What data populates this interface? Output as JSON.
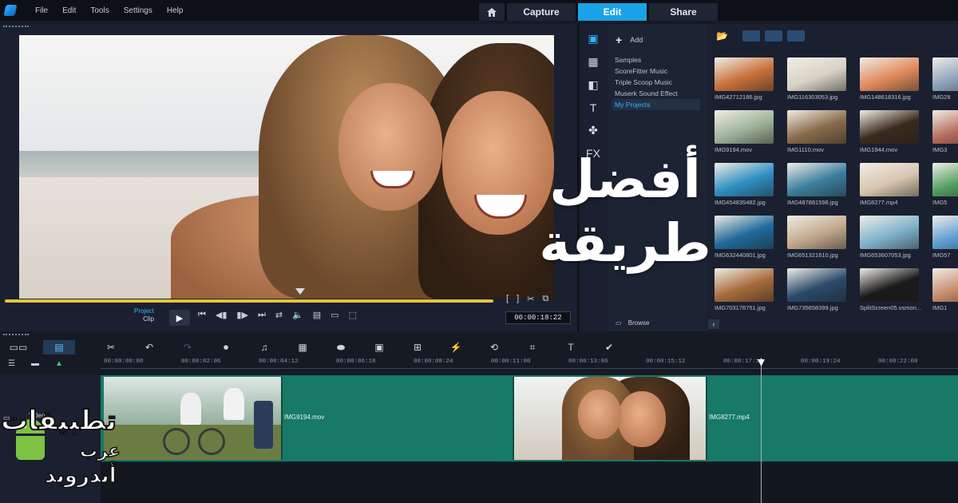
{
  "menu": {
    "items": [
      "File",
      "Edit",
      "Tools",
      "Settings",
      "Help"
    ]
  },
  "tabs": {
    "capture": "Capture",
    "edit": "Edit",
    "share": "Share"
  },
  "player": {
    "mode_project": "Project",
    "mode_clip": "Clip",
    "timecode": "00:00:18:22"
  },
  "library": {
    "add_label": "Add",
    "folders": [
      "Samples",
      "ScoreFitter Music",
      "Triple Scoop Music",
      "Muserk Sound Effect",
      "My Projects"
    ],
    "active_folder": "My Projects",
    "browse_label": "Browse",
    "thumbnails": [
      {
        "name": "IMG42712186.jpg",
        "color": "#c9713a"
      },
      {
        "name": "IMG116303053.jpg",
        "color": "#d9d2c4"
      },
      {
        "name": "IMG148618316.jpg",
        "color": "#e08a5c"
      },
      {
        "name": "IMG28",
        "color": "#8aa0b8"
      },
      {
        "name": "IMG9194.mov",
        "color": "#9fb29a"
      },
      {
        "name": "IMG1110.mov",
        "color": "#8a6a4a"
      },
      {
        "name": "IMG1944.mov",
        "color": "#3a2a1e"
      },
      {
        "name": "IMG3",
        "color": "#b46a5a"
      },
      {
        "name": "IMG454835482.jpg",
        "color": "#2f8fc2"
      },
      {
        "name": "IMG487881598.jpg",
        "color": "#3b7e9e"
      },
      {
        "name": "IMG8277.mp4",
        "color": "#d8c6b0"
      },
      {
        "name": "IMG5",
        "color": "#4f9a5e"
      },
      {
        "name": "IMG632440801.jpg",
        "color": "#1f6a9a"
      },
      {
        "name": "IMG651321610.jpg",
        "color": "#c2a88c"
      },
      {
        "name": "IMG653607053.jpg",
        "color": "#7fb2cc"
      },
      {
        "name": "IMG57",
        "color": "#5a9ccf"
      },
      {
        "name": "IMG703176751.jpg",
        "color": "#a66a3a"
      },
      {
        "name": "IMG735658399.jpg",
        "color": "#2a4a6a"
      },
      {
        "name": "SplitScreen05.vsmon...",
        "color": "#1a1a1a"
      },
      {
        "name": "IMG1",
        "color": "#c48a6a"
      }
    ]
  },
  "overlay": {
    "line1": "أفضل",
    "line2": "طريقة"
  },
  "timeline": {
    "ticks": [
      "00:00:00:00",
      "00:00:02:06",
      "00:00:04:12",
      "00:00:06:18",
      "00:00:08:24",
      "00:00:11:00",
      "00:00:13:06",
      "00:00:15:12",
      "00:00:17:18",
      "00:00:19:24",
      "00:00:22:00"
    ],
    "track_label": "Video",
    "clips": [
      {
        "name": "IMG9194.mov"
      },
      {
        "name": "IMG8277.mp4"
      }
    ]
  },
  "watermark": {
    "line1": "تطبيقات",
    "line2": "عرب",
    "line3": "أندرويد"
  }
}
